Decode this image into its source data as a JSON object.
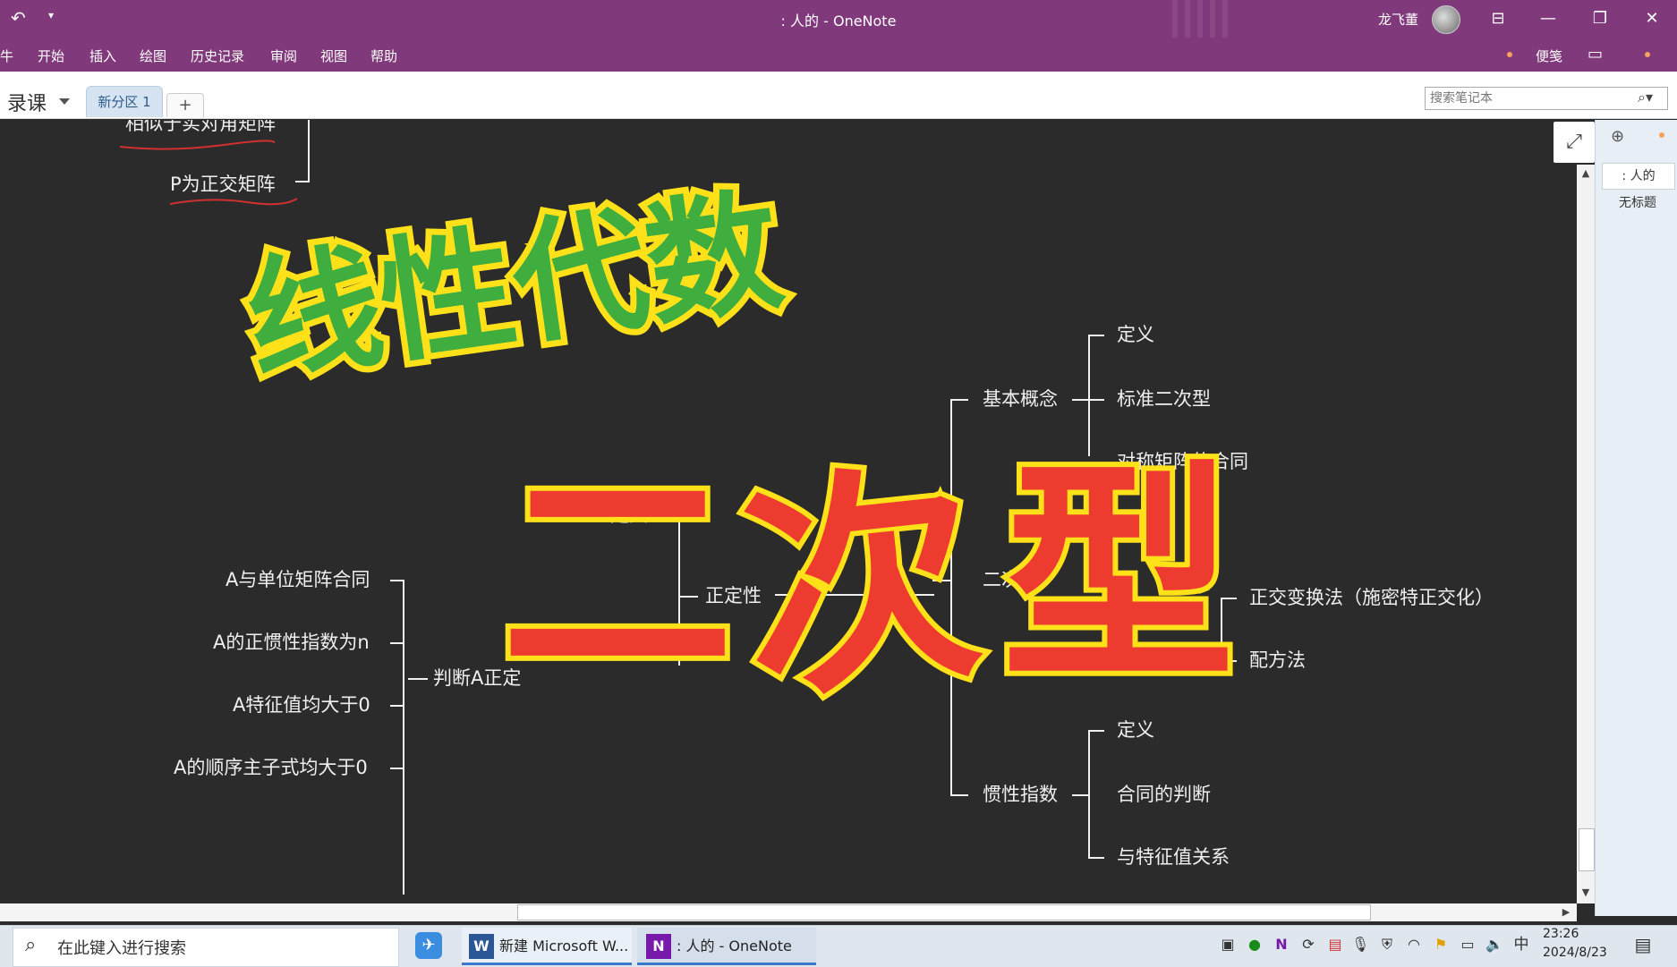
{
  "titlebar": {
    "title": ": 人的  -  OneNote",
    "user": "龙飞董",
    "undo_icon": "undo-icon",
    "restore_icon": "restore-icon",
    "minimize": "—",
    "maximize": "❐",
    "close": "✕",
    "ribbon_display": "⊟"
  },
  "ribbon": {
    "file_fragment": "牛",
    "items": [
      "开始",
      "插入",
      "绘图",
      "历史记录",
      "审阅",
      "视图",
      "帮助"
    ],
    "sticky": "便笺"
  },
  "section_bar": {
    "notebook": "录课",
    "section_tab": "新分区 1",
    "add_tab": "+",
    "search_placeholder": "搜索笔记本"
  },
  "page_panel": {
    "add": "⊕",
    "pages": [
      ": 人的",
      "无标题"
    ]
  },
  "canvas": {
    "expand_icon": "⤢",
    "title_big": "线性代数",
    "subtitle_big": [
      "二",
      "次",
      "型"
    ],
    "mindmap": {
      "top_partial_1": "相似于实对角矩阵",
      "top_partial_2": "P为正交矩阵",
      "center": "二次型",
      "basic": "基本概念",
      "basic_children": [
        "定义",
        "标准二次型",
        "对称矩阵的合同"
      ],
      "positive": "正定性",
      "positive_children": [
        "定义"
      ],
      "judge": "判断A正定",
      "judge_children": [
        "A与单位矩阵合同",
        "A的正惯性指数为n",
        "A特征值均大于0",
        "A的顺序主子式均大于0"
      ],
      "transform_children": [
        "正交变换法（施密特正交化）",
        "配方法"
      ],
      "inertia": "惯性指数",
      "inertia_children": [
        "定义",
        "合同的判断",
        "与特征值关系"
      ]
    }
  },
  "taskbar": {
    "search": "在此键入进行搜索",
    "apps": [
      "新建 Microsoft W...",
      ": 人的 - OneNote"
    ],
    "ime": "中",
    "time": "23:26",
    "date": "2024/8/23"
  }
}
